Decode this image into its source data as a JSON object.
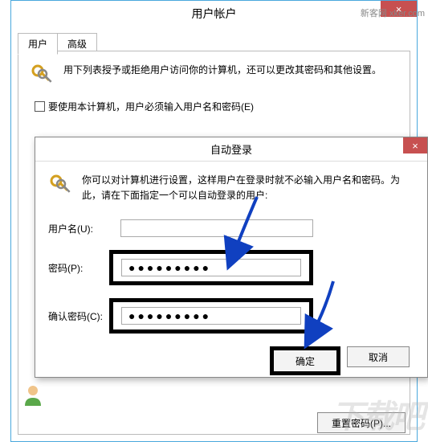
{
  "outer": {
    "title": "用户帐户",
    "close": "×",
    "tabs": {
      "users": "用户",
      "advanced": "高级"
    },
    "description": "用下列表授予或拒绝用户访问你的计算机，还可以更改其密码和其他设置。",
    "checkbox_label": "要使用本计算机，用户必须输入用户名和密码(E)",
    "reset_button": "重置密码(P)..."
  },
  "inner": {
    "title": "自动登录",
    "close": "×",
    "description": "你可以对计算机进行设置，这样用户在登录时就不必输入用户名和密码。为此，请在下面指定一个可以自动登录的用户:",
    "username_label": "用户名(U):",
    "username_value": "",
    "password_label": "密码(P):",
    "password_mask": "●●●●●●●●●",
    "confirm_label": "确认密码(C):",
    "confirm_mask": "●●●●●●●●●",
    "ok": "确定",
    "cancel": "取消"
  },
  "icons": {
    "keys_top": "keys-icon",
    "keys_inner": "keys-icon",
    "user": "user-icon"
  },
  "watermark": {
    "top": "新客网 xker.com",
    "bottom": "下载吧"
  }
}
